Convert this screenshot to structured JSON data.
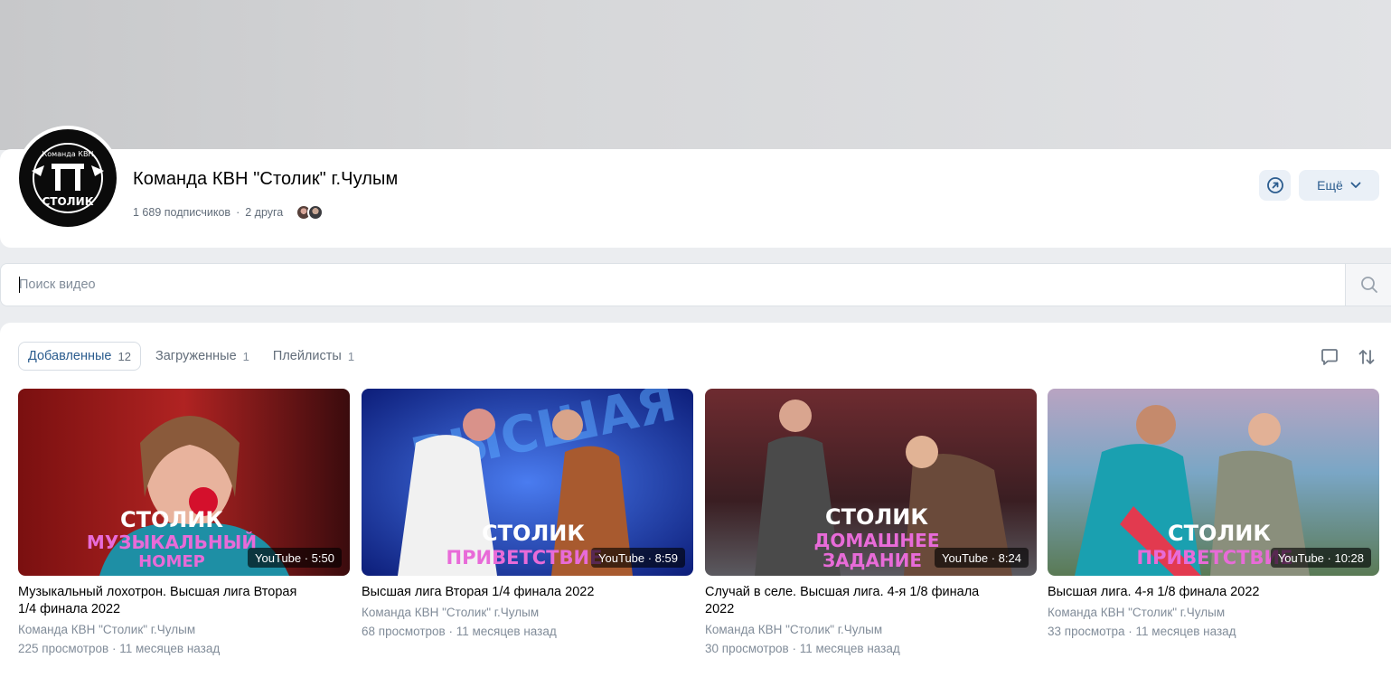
{
  "group": {
    "title": "Команда КВН \"Столик\" г.Чулым",
    "subscribers": "1 689 подписчиков",
    "friends": "2 друга",
    "logo_text_top": "Команда КВН",
    "logo_text_bottom": "СТОЛИК"
  },
  "actions": {
    "share_icon": "share-arrow-icon",
    "more_label": "Ещё"
  },
  "search": {
    "placeholder": "Поиск видео",
    "icon": "search-icon"
  },
  "tabs": [
    {
      "label": "Добавленные",
      "count": "12",
      "active": true
    },
    {
      "label": "Загруженные",
      "count": "1",
      "active": false
    },
    {
      "label": "Плейлисты",
      "count": "1",
      "active": false
    }
  ],
  "toolbar": {
    "comment_icon": "comment-icon",
    "sort_icon": "sort-icon"
  },
  "videos": [
    {
      "badge": "YouTube · 5:50",
      "title": "Музыкальный лохотрон. Высшая лига Вторая 1/4 финала 2022",
      "author": "Команда КВН \"Столик\" г.Чулым",
      "stats": "225 просмотров · 11 месяцев назад",
      "overlay_line1": "СТОЛИК",
      "overlay_line2": "МУЗЫКАЛЬНЫЙ",
      "overlay_line3": "НОМЕР"
    },
    {
      "badge": "YouTube · 8:59",
      "title": "Высшая лига Вторая 1/4 финала 2022",
      "author": "Команда КВН \"Столик\" г.Чулым",
      "stats": "68 просмотров · 11 месяцев назад",
      "overlay_line1": "СТОЛИК",
      "overlay_line2": "ПРИВЕТСТВИЕ",
      "overlay_line3": ""
    },
    {
      "badge": "YouTube · 8:24",
      "title": "Случай в селе. Высшая лига. 4-я 1/8 финала 2022",
      "author": "Команда КВН \"Столик\" г.Чулым",
      "stats": "30 просмотров · 11 месяцев назад",
      "overlay_line1": "СТОЛИК",
      "overlay_line2": "ДОМАШНЕЕ",
      "overlay_line3": "ЗАДАНИЕ"
    },
    {
      "badge": "YouTube · 10:28",
      "title": "Высшая лига. 4-я 1/8 финала 2022",
      "author": "Команда КВН \"Столик\" г.Чулым",
      "stats": "33 просмотра · 11 месяцев назад",
      "overlay_line1": "СТОЛИК",
      "overlay_line2": "ПРИВЕТСТВИЕ",
      "overlay_line3": ""
    }
  ],
  "colors": {
    "accent": "#2c5d8f",
    "secondary_text": "#818c99",
    "button_bg": "#eaf0f7",
    "overlay_primary": "#ffffff",
    "overlay_secondary": "#e86bd8"
  }
}
